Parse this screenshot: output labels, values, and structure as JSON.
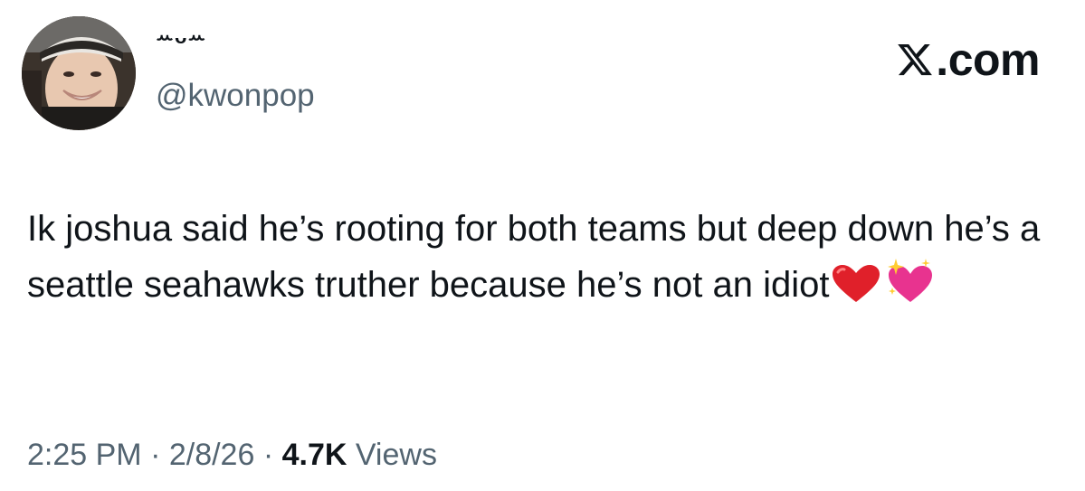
{
  "author": {
    "display_name": "ꕀᴗꕀ",
    "handle": "@kwonpop",
    "avatar_icon": "profile-photo"
  },
  "brand": {
    "logo_icon": "x-logo-icon",
    "text": ".com",
    "logo_color": "#0f1419"
  },
  "tweet": {
    "text": "Ik joshua said he’s rooting for both teams but deep down he’s a seattle seahawks truther because he’s not an idiot",
    "emojis": [
      "red-heart-icon",
      "sparkling-heart-icon"
    ]
  },
  "meta": {
    "time": "2:25 PM",
    "separator1": " · ",
    "date": "2/8/26",
    "separator2": " · ",
    "views_count": "4.7K",
    "views_label": " Views"
  },
  "colors": {
    "text_primary": "#0f1419",
    "text_secondary": "#536471",
    "heart_red": "#e0202a",
    "heart_pink": "#e8338f"
  }
}
